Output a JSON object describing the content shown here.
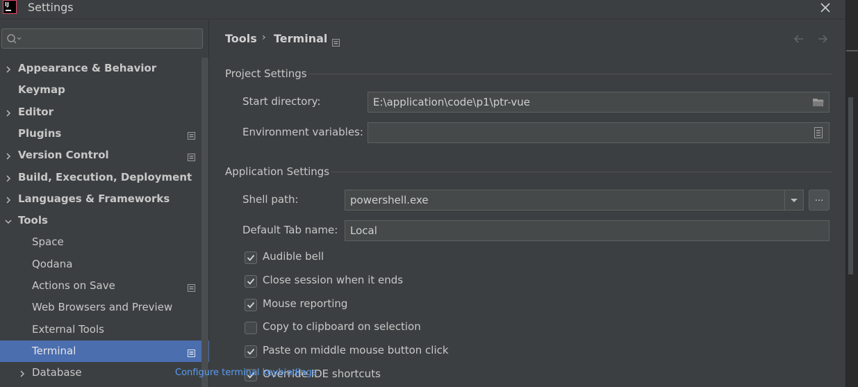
{
  "window": {
    "title": "Settings",
    "app_logo_text": "IJ"
  },
  "sidebar": {
    "search_placeholder": "",
    "items": [
      {
        "label": "Appearance & Behavior",
        "level": 0,
        "expandable": true,
        "expanded": false,
        "badge": false
      },
      {
        "label": "Keymap",
        "level": 0,
        "expandable": false,
        "badge": false
      },
      {
        "label": "Editor",
        "level": 0,
        "expandable": true,
        "expanded": false,
        "badge": false
      },
      {
        "label": "Plugins",
        "level": 0,
        "expandable": false,
        "badge": true
      },
      {
        "label": "Version Control",
        "level": 0,
        "expandable": true,
        "expanded": false,
        "badge": true
      },
      {
        "label": "Build, Execution, Deployment",
        "level": 0,
        "expandable": true,
        "expanded": false,
        "badge": false
      },
      {
        "label": "Languages & Frameworks",
        "level": 0,
        "expandable": true,
        "expanded": false,
        "badge": false
      },
      {
        "label": "Tools",
        "level": 0,
        "expandable": true,
        "expanded": true,
        "badge": false
      },
      {
        "label": "Space",
        "level": 1,
        "expandable": false,
        "badge": false
      },
      {
        "label": "Qodana",
        "level": 1,
        "expandable": false,
        "badge": false
      },
      {
        "label": "Actions on Save",
        "level": 1,
        "expandable": false,
        "badge": true
      },
      {
        "label": "Web Browsers and Preview",
        "level": 1,
        "expandable": false,
        "badge": false
      },
      {
        "label": "External Tools",
        "level": 1,
        "expandable": false,
        "badge": false
      },
      {
        "label": "Terminal",
        "level": 1,
        "expandable": false,
        "badge": true,
        "selected": true
      },
      {
        "label": "Database",
        "level": 1,
        "expandable": true,
        "expanded": false,
        "badge": false
      }
    ]
  },
  "breadcrumb": {
    "parent": "Tools",
    "separator": "›",
    "current": "Terminal"
  },
  "project_settings": {
    "title": "Project Settings",
    "start_directory_label": "Start directory:",
    "start_directory_value": "E:\\application\\code\\p1\\ptr-vue",
    "env_vars_label": "Environment variables:",
    "env_vars_value": ""
  },
  "application_settings": {
    "title": "Application Settings",
    "shell_path_label": "Shell path:",
    "shell_path_value": "powershell.exe",
    "browse_label": "...",
    "tab_name_label": "Default Tab name:",
    "tab_name_value": "Local",
    "checkboxes": [
      {
        "label": "Audible bell",
        "checked": true
      },
      {
        "label": "Close session when it ends",
        "checked": true
      },
      {
        "label": "Mouse reporting",
        "checked": true
      },
      {
        "label": "Copy to clipboard on selection",
        "checked": false
      },
      {
        "label": "Paste on middle mouse button click",
        "checked": true
      },
      {
        "label": "Override IDE shortcuts",
        "checked": true
      }
    ],
    "keybinding_link": "Configure terminal keybindings"
  },
  "colors": {
    "background": "#3c3f41",
    "selection": "#4b6eaf",
    "link": "#589df6"
  }
}
